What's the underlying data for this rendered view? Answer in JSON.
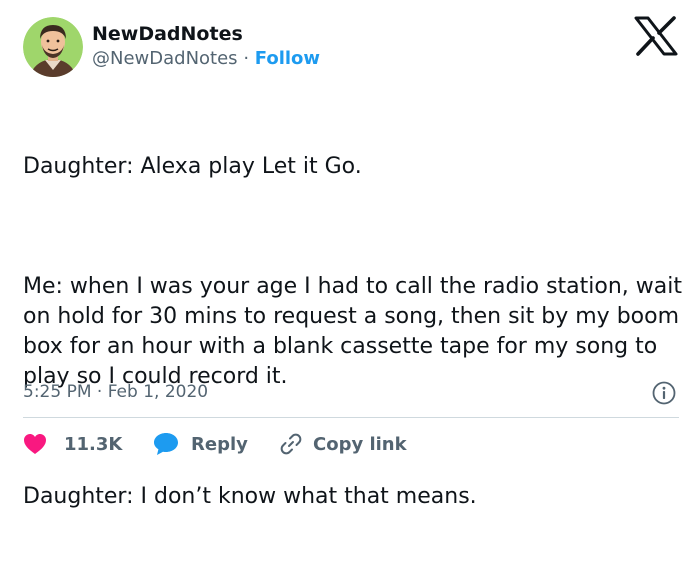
{
  "author": {
    "name": "NewDadNotes",
    "handle": "@NewDadNotes",
    "separator": "·",
    "follow_label": "Follow"
  },
  "tweet": {
    "paragraphs": [
      "Daughter: Alexa play Let it Go.",
      "Me: when I was your age I had to call the radio station, wait on hold for 30 mins to request a song, then sit by my boom box for an hour with a blank cassette tape for my song to play so I could record it.",
      "Daughter: I don’t know what that means."
    ],
    "timestamp": "5:25 PM · Feb 1, 2020"
  },
  "actions": {
    "likes_count": "11.3K",
    "reply_label": "Reply",
    "copy_link_label": "Copy link"
  },
  "icons": {
    "brand": "x-logo-icon",
    "info": "info-icon",
    "like": "heart-icon",
    "reply": "speech-bubble-icon",
    "copy": "link-icon"
  },
  "colors": {
    "text": "#0f1419",
    "secondary": "#536471",
    "accent": "#1d9bf0",
    "like": "#f91880",
    "divider": "#cfd9de"
  }
}
